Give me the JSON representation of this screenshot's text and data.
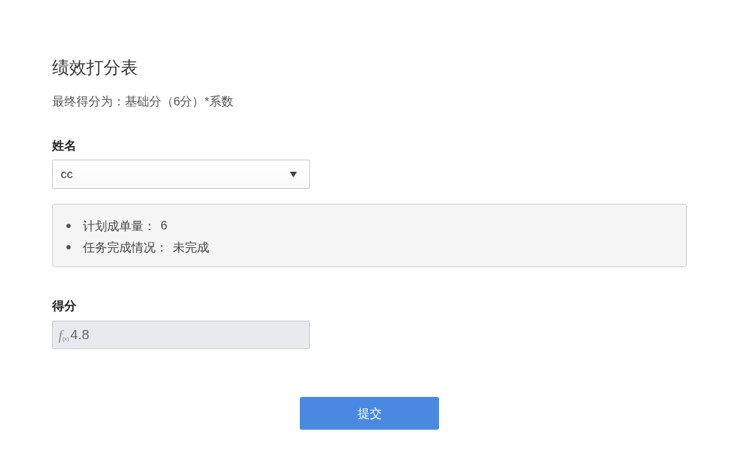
{
  "form": {
    "title": "绩效打分表",
    "description": "最终得分为：基础分（6分）*系数"
  },
  "name_field": {
    "label": "姓名",
    "value": "cc"
  },
  "info": [
    {
      "label": "计划成单量：",
      "value": "6"
    },
    {
      "label": "任务完成情况：",
      "value": "未完成"
    }
  ],
  "score_field": {
    "label": "得分",
    "formula_sign": "*f*$_{(x)}$",
    "value": "4.8",
    "disabled": true
  },
  "submit_button": "提交"
}
